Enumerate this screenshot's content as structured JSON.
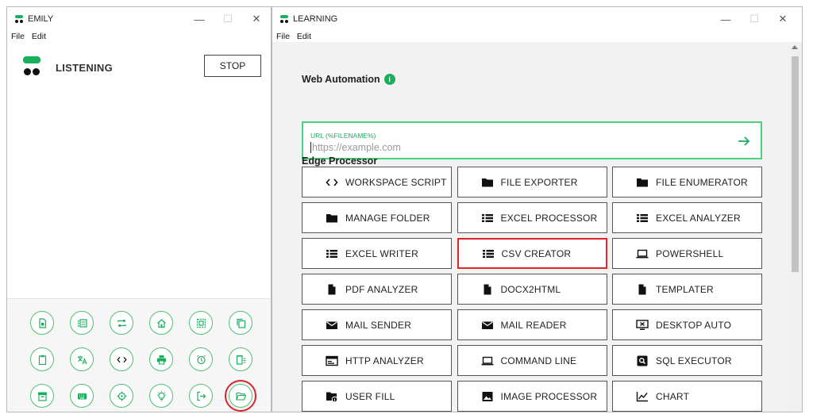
{
  "emily": {
    "title": "EMILY",
    "menu": [
      "File",
      "Edit"
    ],
    "status": "LISTENING",
    "stop_label": "STOP",
    "tools": [
      {
        "icon": "document-icon"
      },
      {
        "icon": "list-form-icon"
      },
      {
        "icon": "repeat-icon"
      },
      {
        "icon": "home-icon"
      },
      {
        "icon": "frame-icon"
      },
      {
        "icon": "copy-icon"
      },
      {
        "icon": "clipboard-icon"
      },
      {
        "icon": "translate-icon"
      },
      {
        "icon": "code-icon"
      },
      {
        "icon": "printer-icon"
      },
      {
        "icon": "alarm-icon"
      },
      {
        "icon": "delete-list-icon"
      },
      {
        "icon": "archive-icon"
      },
      {
        "icon": "keyboard-icon"
      },
      {
        "icon": "crosshair-icon"
      },
      {
        "icon": "lightbulb-icon"
      },
      {
        "icon": "exit-icon"
      },
      {
        "icon": "folder-open-icon",
        "highlighted": true
      }
    ]
  },
  "learning": {
    "title": "LEARNING",
    "menu": [
      "File",
      "Edit"
    ],
    "web_automation": {
      "heading": "Web Automation",
      "info": "i",
      "url_label": "URL (%FILENAME%)",
      "url_placeholder": "https://example.com"
    },
    "edge_processor": {
      "heading": "Edge Processor",
      "buttons": [
        {
          "label": "WORKSPACE SCRIPT",
          "icon": "code-icon"
        },
        {
          "label": "FILE EXPORTER",
          "icon": "folder-icon"
        },
        {
          "label": "FILE ENUMERATOR",
          "icon": "folder-icon"
        },
        {
          "label": "MANAGE FOLDER",
          "icon": "folder-icon"
        },
        {
          "label": "EXCEL PROCESSOR",
          "icon": "list-icon"
        },
        {
          "label": "EXCEL ANALYZER",
          "icon": "list-icon"
        },
        {
          "label": "EXCEL WRITER",
          "icon": "list-icon"
        },
        {
          "label": "CSV CREATOR",
          "icon": "list-icon",
          "selected": true
        },
        {
          "label": "POWERSHELL",
          "icon": "laptop-icon"
        },
        {
          "label": "PDF ANALYZER",
          "icon": "file-icon"
        },
        {
          "label": "DOCX2HTML",
          "icon": "file-icon"
        },
        {
          "label": "TEMPLATER",
          "icon": "file-icon"
        },
        {
          "label": "MAIL SENDER",
          "icon": "mail-icon"
        },
        {
          "label": "MAIL READER",
          "icon": "mail-icon"
        },
        {
          "label": "DESKTOP AUTO",
          "icon": "desktop-x-icon"
        },
        {
          "label": "HTTP ANALYZER",
          "icon": "browser-icon"
        },
        {
          "label": "COMMAND LINE",
          "icon": "laptop-icon"
        },
        {
          "label": "SQL EXECUTOR",
          "icon": "search-box-icon"
        },
        {
          "label": "USER FILL",
          "icon": "folder-info-icon"
        },
        {
          "label": "IMAGE PROCESSOR",
          "icon": "image-icon"
        },
        {
          "label": "CHART",
          "icon": "chart-icon"
        }
      ]
    }
  },
  "colors": {
    "accent": "#1aaf5d",
    "url_border": "#4cd27f",
    "selected": "#e0252b",
    "tool_border": "#4fbf73"
  }
}
